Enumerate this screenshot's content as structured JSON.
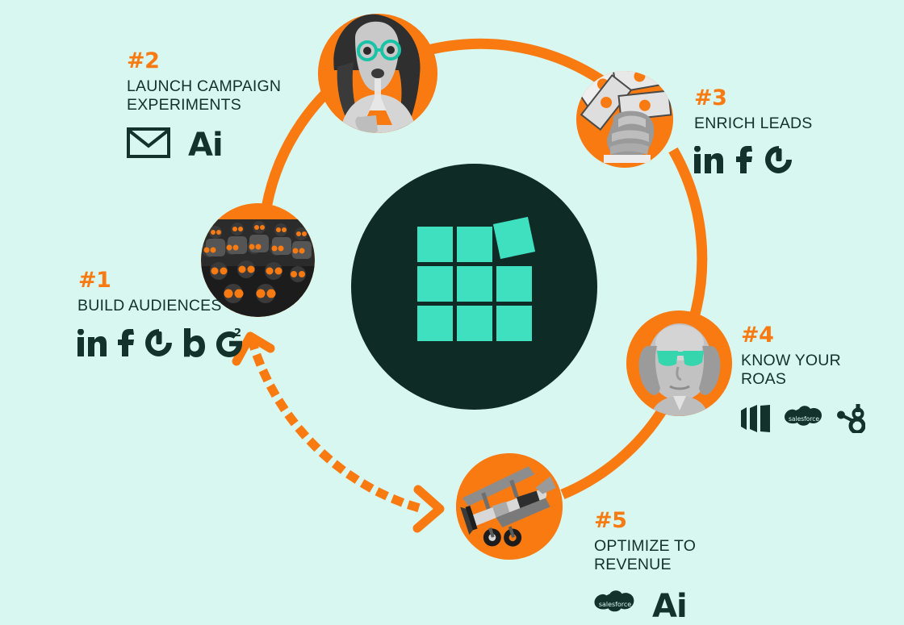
{
  "meta": {
    "diagram_title": "Marketing Lifecycle Loop",
    "background_color": "#d8f7f1",
    "accent_orange": "#f97a10",
    "dark_green": "#0f2b26",
    "teal": "#3fe0c0"
  },
  "center": {
    "logo_name": "metadata-grid-logo",
    "circle_color": "#0f2b26",
    "tile_color": "#3fe0c0",
    "tile_count": 9,
    "tilted_tile_index": 2
  },
  "steps": [
    {
      "id": "step1",
      "number": "#1",
      "title": "BUILD AUDIENCES",
      "photo_alt": "vintage-crowd-orange-glasses-photo",
      "icons": [
        {
          "name": "linkedin-icon",
          "label": "in"
        },
        {
          "name": "facebook-icon",
          "label": "f"
        },
        {
          "name": "power-circle-icon",
          "label": "power"
        },
        {
          "name": "bombora-icon",
          "label": "b"
        },
        {
          "name": "g2-icon",
          "label": "G2"
        }
      ]
    },
    {
      "id": "step2",
      "number": "#2",
      "title": "LAUNCH CAMPAIGN\nEXPERIMENTS",
      "photo_alt": "woman-teal-glasses-flask-photo",
      "icons": [
        {
          "name": "envelope-icon",
          "label": "email"
        },
        {
          "name": "adobe-ai-icon",
          "label": "Ai"
        }
      ]
    },
    {
      "id": "step3",
      "number": "#3",
      "title": "ENRICH LEADS",
      "photo_alt": "hand-holding-dollar-bills-photo",
      "icons": [
        {
          "name": "linkedin-icon",
          "label": "in"
        },
        {
          "name": "facebook-icon",
          "label": "f"
        },
        {
          "name": "power-circle-icon",
          "label": "power"
        }
      ]
    },
    {
      "id": "step4",
      "number": "#4",
      "title": "KNOW YOUR\nROAS",
      "photo_alt": "ben-franklin-teal-sunglasses-photo",
      "icons": [
        {
          "name": "marketo-icon",
          "label": "marketo"
        },
        {
          "name": "salesforce-icon",
          "label": "salesforce"
        },
        {
          "name": "hubspot-icon",
          "label": "hubspot"
        }
      ]
    },
    {
      "id": "step5",
      "number": "#5",
      "title": "OPTIMIZE TO\nREVENUE",
      "photo_alt": "vintage-biplane-photo",
      "icons": [
        {
          "name": "salesforce-icon",
          "label": "salesforce"
        },
        {
          "name": "adobe-ai-icon",
          "label": "Ai"
        }
      ]
    }
  ],
  "feedback_arrow": {
    "name": "dotted-feedback-arrow",
    "style": "dotted",
    "color": "#f97a10",
    "direction": "bidirectional"
  },
  "salesforce_wordmark": "salesforce",
  "g2_superscript": "2"
}
